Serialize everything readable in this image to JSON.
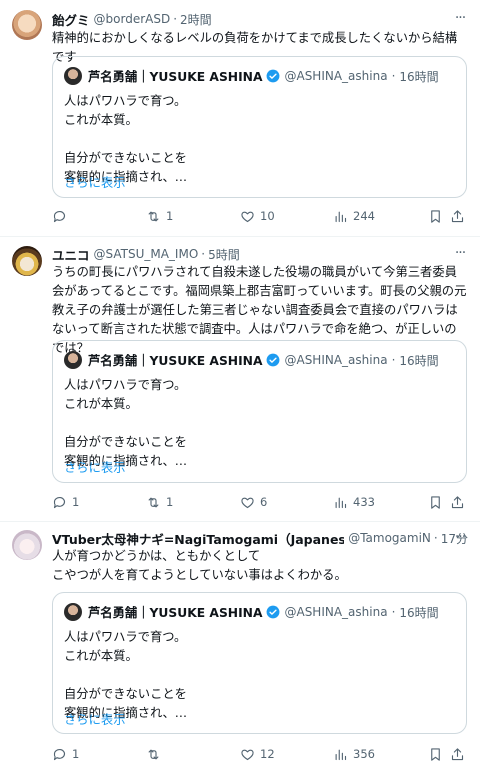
{
  "posts": [
    {
      "name": "飴グミ",
      "handle": "@borderASD",
      "time": "2時間",
      "text": "精神的におかしくなるレベルの負荷をかけてまで成長したくないから結構です",
      "quote": {
        "name": "芦名勇舗｜YUSUKE ASHINA",
        "handle": "@ASHINA_ashina",
        "time": "16時間",
        "text": "人はパワハラで育つ。\nこれが本質。\n\n自分ができないことを\n客観的に指摘され、…",
        "more": "さらに表示"
      },
      "stats": {
        "replies": "",
        "reposts": "1",
        "likes": "10",
        "views": "244"
      }
    },
    {
      "name": "ユニコ",
      "handle": "@SATSU_MA_IMO",
      "time": "5時間",
      "text": "うちの町長にパワハラされて自殺未遂した役場の職員がいて今第三者委員会があってるとこです。福岡県築上郡吉富町っていいます。町長の父親の元教え子の弁護士が選任した第三者じゃない調査委員会で直接のパワハラはないって断言された状態で調査中。人はパワハラで命を絶つ、が正しいのでは？",
      "quote": {
        "name": "芦名勇舗｜YUSUKE ASHINA",
        "handle": "@ASHINA_ashina",
        "time": "16時間",
        "text": "人はパワハラで育つ。\nこれが本質。\n\n自分ができないことを\n客観的に指摘され、…",
        "more": "さらに表示"
      },
      "stats": {
        "replies": "1",
        "reposts": "1",
        "likes": "6",
        "views": "433"
      }
    },
    {
      "name": "VTuber太母神ナギ=NagiTamogami（JapaneseV",
      "handle": "@TamogamiN",
      "time": "17分",
      "text": "人が育つかどうかは、ともかくとして\nこやつが人を育てようとしていない事はよくわかる。",
      "quote": {
        "name": "芦名勇舗｜YUSUKE ASHINA",
        "handle": "@ASHINA_ashina",
        "time": "16時間",
        "text": "人はパワハラで育つ。\nこれが本質。\n\n自分ができないことを\n客観的に指摘され、…",
        "more": "さらに表示"
      },
      "stats": {
        "replies": "1",
        "reposts": "",
        "likes": "12",
        "views": "356"
      }
    }
  ],
  "separator": "·",
  "more_icon": "···",
  "colors": {
    "link": "#1d9bf0",
    "verified": "#1d9bf0",
    "muted": "#536471",
    "border": "#cfd9de"
  }
}
